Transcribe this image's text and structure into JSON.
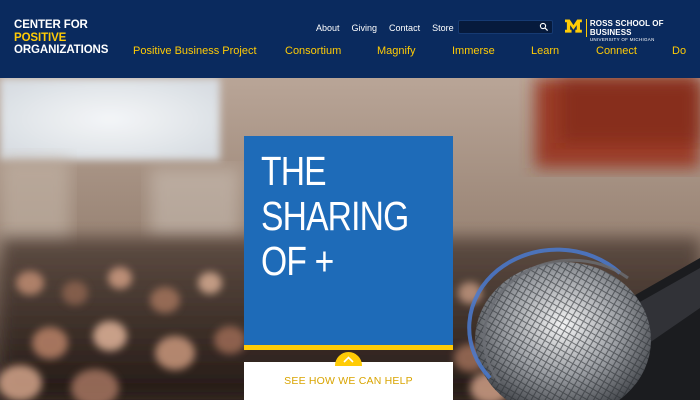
{
  "logo": {
    "line1": "CENTER FOR",
    "line2": "POSITIVE",
    "line3": "ORGANIZATIONS"
  },
  "utility_nav": [
    "About",
    "Giving",
    "Contact",
    "Store"
  ],
  "search": {
    "placeholder": ""
  },
  "ross": {
    "name": "ROSS SCHOOL OF BUSINESS",
    "sub": "UNIVERSITY OF MICHIGAN"
  },
  "main_nav": [
    "Positive Business Project",
    "Consortium",
    "Magnify",
    "Immerse",
    "Learn",
    "Connect",
    "Do"
  ],
  "hero": {
    "line1": "THE",
    "line2": "SHARING",
    "line3": "OF +",
    "cta": "SEE HOW WE CAN HELP"
  },
  "colors": {
    "navy": "#0a2a5e",
    "maize": "#ffcb05",
    "promo_blue": "#1e6bb8"
  },
  "icons": [
    "search-icon",
    "block-m-icon",
    "chevron-up-icon"
  ]
}
